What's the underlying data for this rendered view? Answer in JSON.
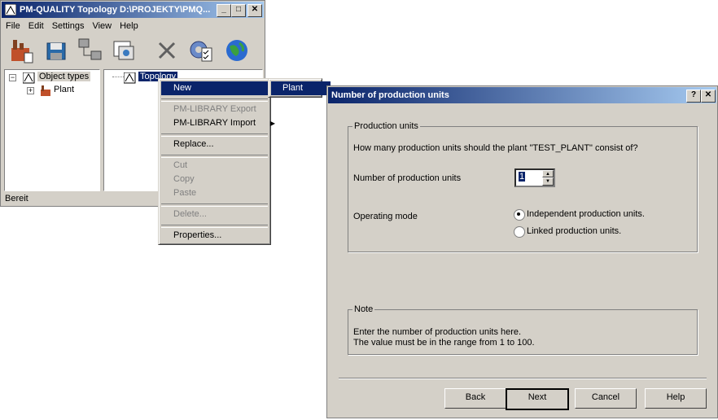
{
  "main_window": {
    "title": "PM-QUALITY Topology D:\\PROJEKTY\\PMQ...",
    "controls": {
      "minimize": "_",
      "maximize": "□",
      "close": "✕"
    },
    "menu": [
      "File",
      "Edit",
      "Settings",
      "View",
      "Help"
    ],
    "toolbar": [
      "factory-icon",
      "save-icon",
      "network-icon",
      "print-preview-icon",
      "delete-icon",
      "gear-checklist-icon",
      "globe-icon"
    ],
    "left_tree": {
      "root_label": "Object types",
      "root_expander": "−",
      "child_label": "Plant",
      "child_expander": "+"
    },
    "right_tree": {
      "root_label": "Topology"
    },
    "status": "Bereit"
  },
  "context_menu": {
    "items": [
      {
        "label": "New",
        "state": "selected",
        "submenu": true
      },
      {
        "label": "PM-LIBRARY Export",
        "state": "disabled"
      },
      {
        "label": "PM-LIBRARY Import",
        "state": "enabled",
        "submenu": true
      },
      {
        "label": "Replace...",
        "state": "enabled"
      },
      {
        "label": "Cut",
        "state": "disabled"
      },
      {
        "label": "Copy",
        "state": "disabled"
      },
      {
        "label": "Paste",
        "state": "disabled"
      },
      {
        "label": "Delete...",
        "state": "disabled"
      },
      {
        "label": "Properties...",
        "state": "enabled"
      }
    ],
    "submenu_item": "Plant"
  },
  "dialog": {
    "title": "Number of production units",
    "controls": {
      "help": "?",
      "close": "✕"
    },
    "group1_title": "Production units",
    "question": "How many production units should the plant \"TEST_PLANT\" consist of?",
    "units_label": "Number of production units",
    "units_value": "1",
    "mode_label": "Operating mode",
    "mode_options": [
      {
        "label": "Independent production units.",
        "selected": true
      },
      {
        "label": "Linked production units.",
        "selected": false
      }
    ],
    "note_title": "Note",
    "note_line1": "Enter the number of production units here.",
    "note_line2": "The value must be in the range from 1 to 100.",
    "buttons": {
      "back": "Back",
      "next": "Next",
      "cancel": "Cancel",
      "help": "Help"
    }
  },
  "colors": {
    "face": "#d4d0c8",
    "title_active": "#0a246a",
    "highlight": "#0a246a"
  }
}
